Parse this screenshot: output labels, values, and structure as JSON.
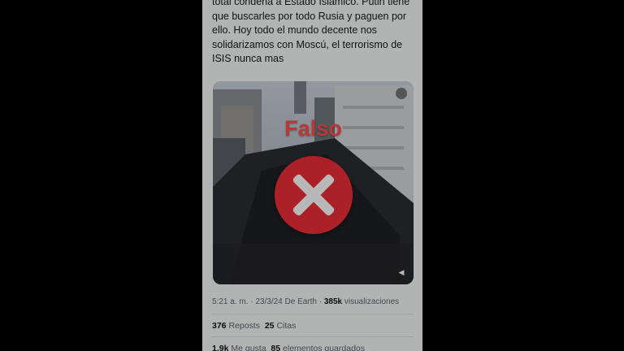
{
  "tweet": {
    "text_lines": [
      "total condena a Estado Islámico. Putin tiene",
      "que buscarles por todo Rusia y paguen por",
      "ello. Hoy todo el mundo decente nos",
      "solidarizamos con Moscú, el terrorismo de",
      "ISIS nunca mas"
    ]
  },
  "overlay": {
    "label": "Falso",
    "color": "#ef2f38"
  },
  "meta": {
    "time": "5:21 a. m.",
    "sep1": " · ",
    "date": "23/3/24",
    "source": " De Earth",
    "sep2": " · ",
    "views_count": "385k",
    "views_label": " visualizaciones"
  },
  "stats": {
    "reposts_count": "376",
    "reposts_label": "Reposts",
    "quotes_count": "25",
    "quotes_label": "Citas",
    "likes_count": "1,9k",
    "likes_label": "Me gusta",
    "saves_count": "85",
    "saves_label": "elementos guardados"
  },
  "icons": {
    "media_corner": "media-icon",
    "sound": "volume-icon"
  }
}
